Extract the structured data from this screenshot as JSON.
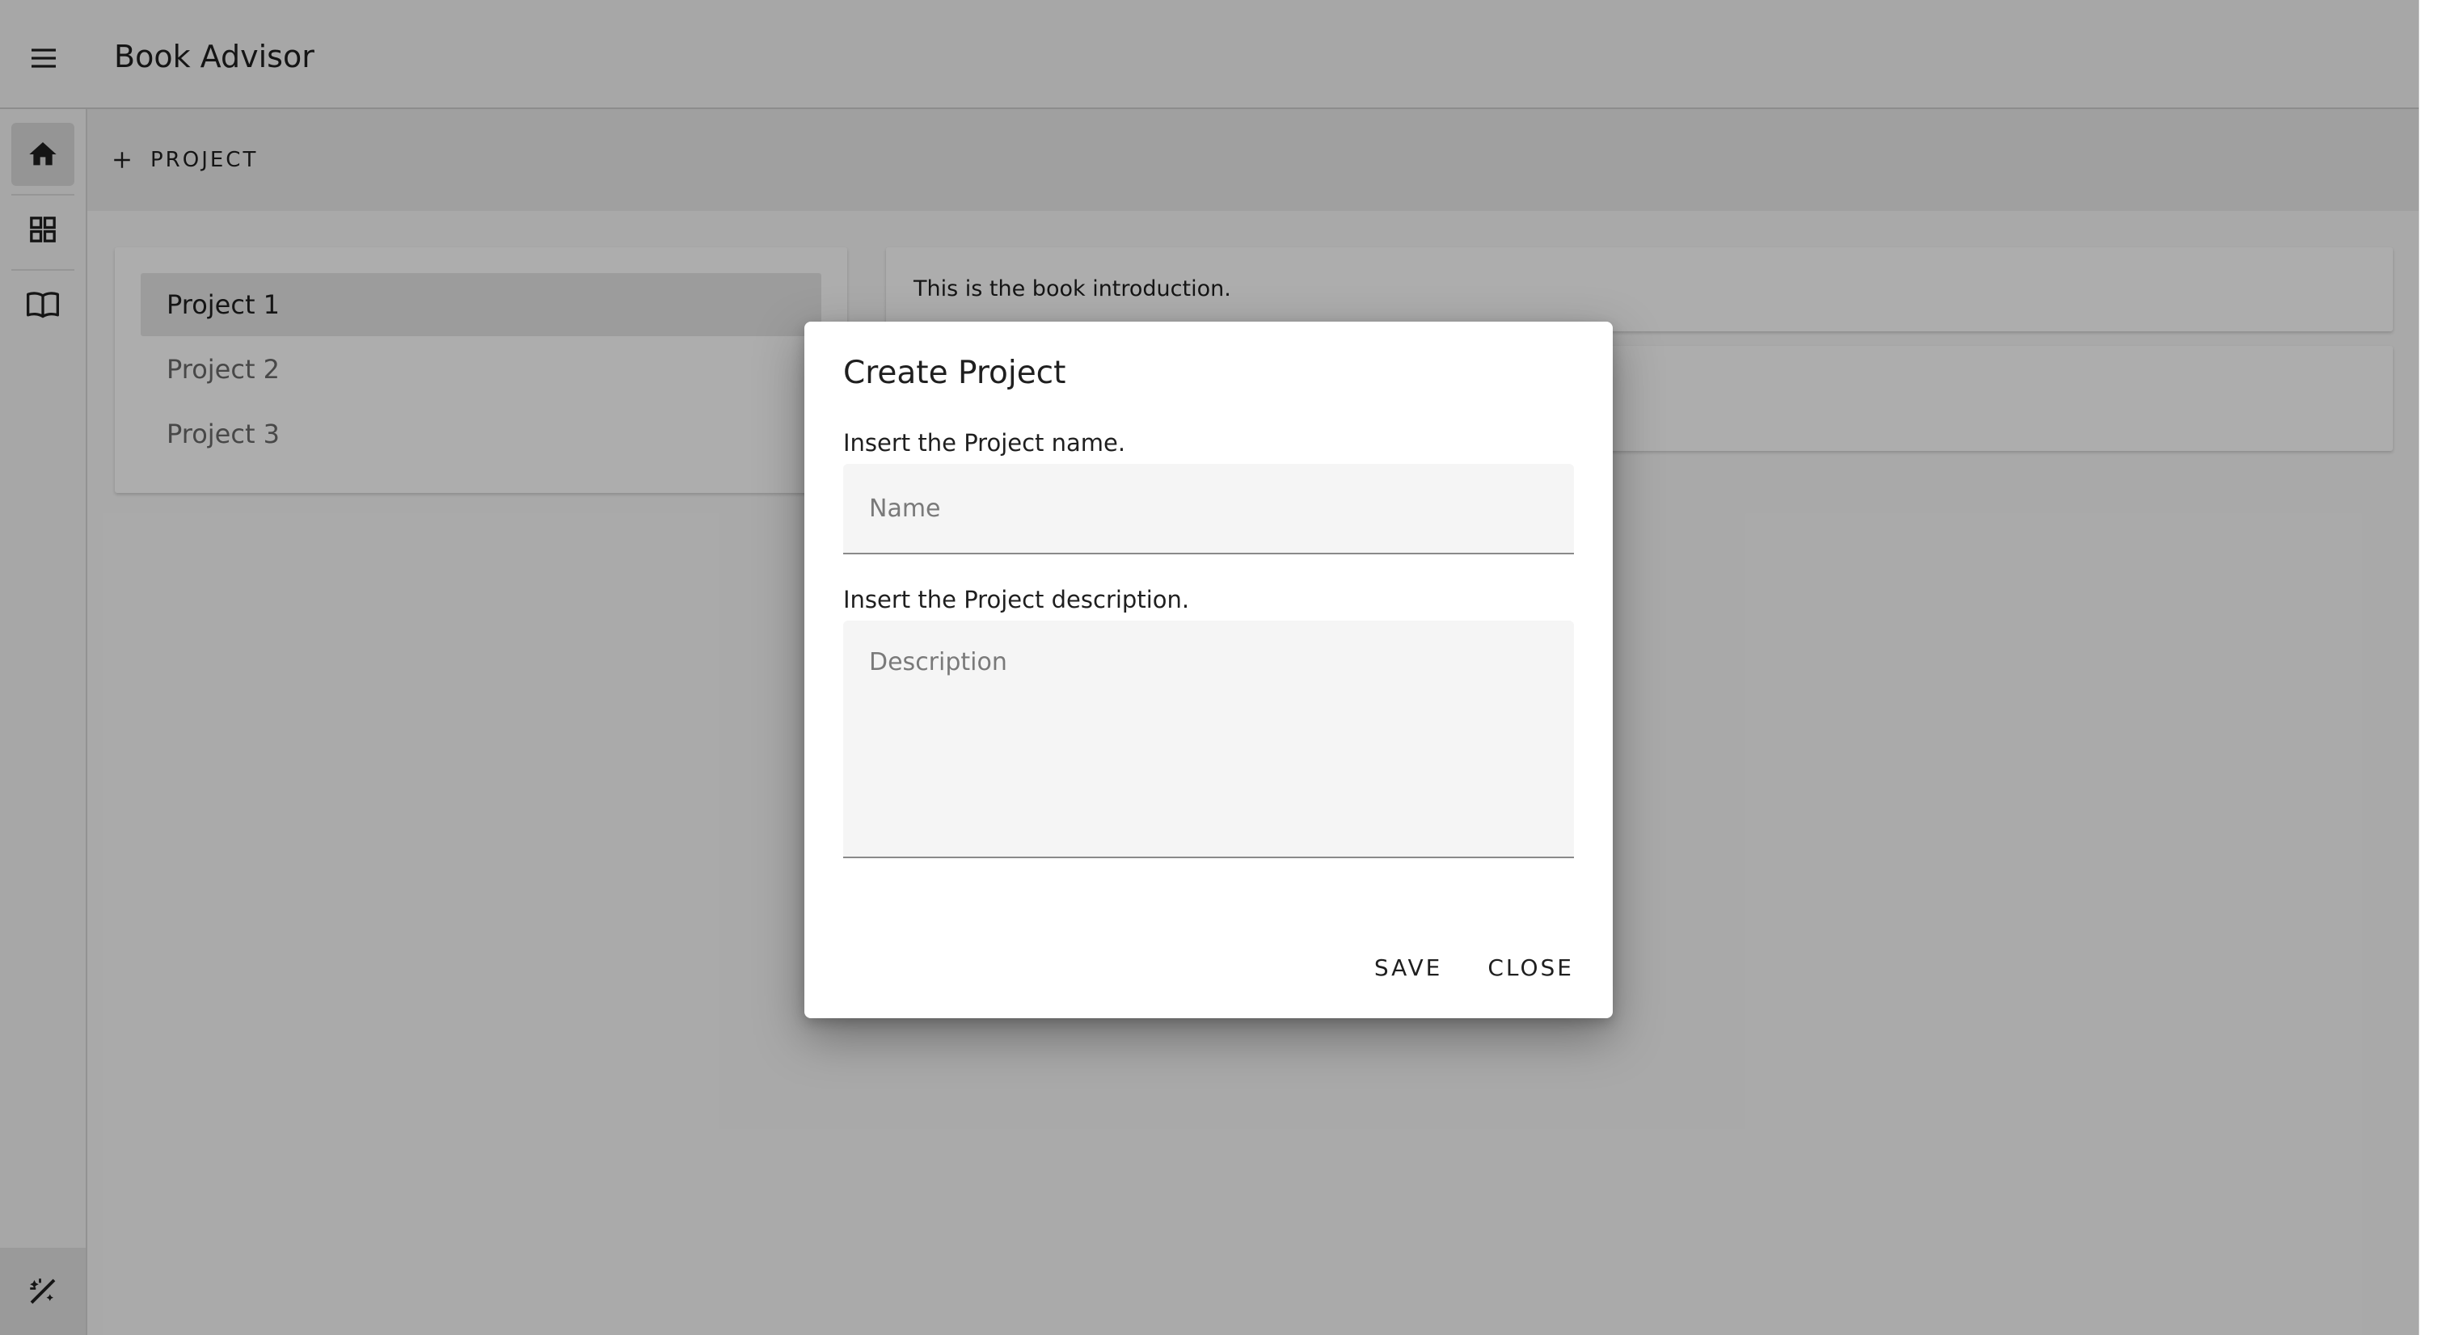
{
  "app": {
    "title": "Book Advisor"
  },
  "header": {
    "menu_icon": "menu-icon"
  },
  "rail": {
    "items": [
      {
        "icon": "home-icon",
        "active": true
      },
      {
        "icon": "dashboard-grid-icon",
        "active": false
      },
      {
        "icon": "book-icon",
        "active": false
      }
    ],
    "bottom_icon": "auto-fix-icon"
  },
  "toolbar": {
    "add_icon": "plus-icon",
    "add_project_label": "PROJECT"
  },
  "projects": {
    "items": [
      {
        "label": "Project 1",
        "selected": true
      },
      {
        "label": "Project 2",
        "selected": false
      },
      {
        "label": "Project 3",
        "selected": false
      }
    ]
  },
  "intro": {
    "text": "This is the book introduction."
  },
  "dialog": {
    "title": "Create Project",
    "name_label": "Insert the Project name.",
    "name_placeholder": "Name",
    "name_value": "",
    "description_label": "Insert the Project description.",
    "description_placeholder": "Description",
    "description_value": "",
    "save_label": "SAVE",
    "close_label": "CLOSE"
  }
}
